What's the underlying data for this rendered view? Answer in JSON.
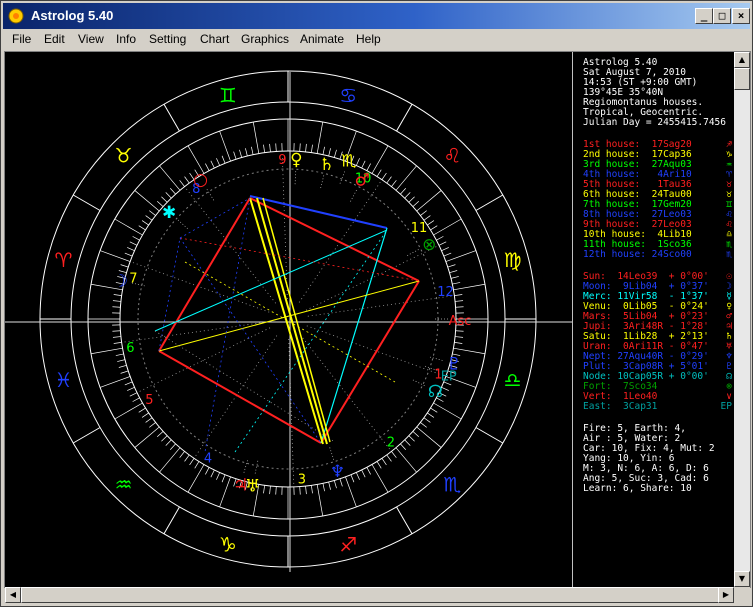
{
  "window": {
    "title": "Astrolog 5.40",
    "minimize": "_",
    "maximize": "□",
    "close": "×"
  },
  "menu": [
    "File",
    "Edit",
    "View",
    "Info",
    "Setting",
    "Chart",
    "Graphics",
    "Animate",
    "Help"
  ],
  "info": {
    "header": [
      "Astrolog 5.40",
      "Sat August 7, 2010",
      "14:53 (ST +9:00 GMT)",
      "139°45E 35°40N",
      "Regiomontanus houses.",
      "Tropical, Geocentric.",
      "Julian Day = 2455415.7456"
    ],
    "houses": [
      {
        "text": "1st house:  17Sag20",
        "color": "#ff2020",
        "glyph": "♐"
      },
      {
        "text": "2nd house:  17Cap36",
        "color": "#ffff00",
        "glyph": "♑"
      },
      {
        "text": "3rd house:  27Aqu03",
        "color": "#00ff00",
        "glyph": "♒"
      },
      {
        "text": "4th house:   4Ari10",
        "color": "#2040ff",
        "glyph": "♈"
      },
      {
        "text": "5th house:   1Tau36",
        "color": "#ff2020",
        "glyph": "♉"
      },
      {
        "text": "6th house:  24Tau00",
        "color": "#ffff00",
        "glyph": "♉"
      },
      {
        "text": "7th house:  17Gem20",
        "color": "#00ff00",
        "glyph": "♊"
      },
      {
        "text": "8th house:  27Leo03",
        "color": "#2040ff",
        "glyph": "♌"
      },
      {
        "text": "9th house:  27Leo03",
        "color": "#ff2020",
        "glyph": "♌"
      },
      {
        "text": "10th house:  4Lib10",
        "color": "#ffff00",
        "glyph": "♎"
      },
      {
        "text": "11th house:  1Sco36",
        "color": "#00ff00",
        "glyph": "♏"
      },
      {
        "text": "12th house: 24Sco00",
        "color": "#2040ff",
        "glyph": "♏"
      }
    ],
    "planets": [
      {
        "text": "Sun:  14Leo39  + 0°00'",
        "color": "#ff2020",
        "glyph": "☉"
      },
      {
        "text": "Moon:  9Lib04  + 0°37'",
        "color": "#2040ff",
        "glyph": "☽"
      },
      {
        "text": "Merc: 11Vir58  - 1°37'",
        "color": "#00ffff",
        "glyph": "☿"
      },
      {
        "text": "Venu:  0Lib05  - 0°24'",
        "color": "#ffff00",
        "glyph": "♀"
      },
      {
        "text": "Mars:  5Lib04  + 0°23'",
        "color": "#ff2020",
        "glyph": "♂"
      },
      {
        "text": "Jupi:  3Ari48R - 1°28'",
        "color": "#ff2020",
        "glyph": "♃"
      },
      {
        "text": "Satu:  1Lib28  + 2°13'",
        "color": "#ffff00",
        "glyph": "♄"
      },
      {
        "text": "Uran:  0Ari11R - 0°47'",
        "color": "#ff2020",
        "glyph": "♅"
      },
      {
        "text": "Nept: 27Aqu40R - 0°29'",
        "color": "#2040ff",
        "glyph": "♆"
      },
      {
        "text": "Plut:  3Cap08R + 5°01'",
        "color": "#2040ff",
        "glyph": "♇"
      },
      {
        "text": "Node: 10Cap05R + 0°00'",
        "color": "#00c0c0",
        "glyph": "☊"
      },
      {
        "text": "Fort:  7Sco34",
        "color": "#00a000",
        "glyph": "⊗"
      },
      {
        "text": "Vert:  1Leo40",
        "color": "#ff2020",
        "glyph": "∨"
      },
      {
        "text": "East:  3Cap31",
        "color": "#00a0a0",
        "glyph": "EP"
      }
    ],
    "summary": [
      "Fire: 5, Earth: 4,",
      "Air : 5, Water: 2",
      "Car: 10, Fix: 4, Mut: 2",
      "Yang: 10, Yin: 6",
      "M: 3, N: 6, A: 6, D: 6",
      "Ang: 5, Suc: 3, Cad: 6",
      "Learn: 6, Share: 10"
    ]
  },
  "wheel": {
    "signs": [
      {
        "glyph": "♐",
        "color": "#ff2020",
        "deg": 255
      },
      {
        "glyph": "♑",
        "color": "#ffff00",
        "deg": 285
      },
      {
        "glyph": "♒",
        "color": "#00ff00",
        "deg": 315
      },
      {
        "glyph": "♓",
        "color": "#2040ff",
        "deg": 345
      },
      {
        "glyph": "♈",
        "color": "#ff2020",
        "deg": 15
      },
      {
        "glyph": "♉",
        "color": "#ffff00",
        "deg": 45
      },
      {
        "glyph": "♊",
        "color": "#00ff00",
        "deg": 75
      },
      {
        "glyph": "♋",
        "color": "#2040ff",
        "deg": 105
      },
      {
        "glyph": "♌",
        "color": "#ff2020",
        "deg": 135
      },
      {
        "glyph": "♍",
        "color": "#ffff00",
        "deg": 165
      },
      {
        "glyph": "♎",
        "color": "#00ff00",
        "deg": 195
      },
      {
        "glyph": "♏",
        "color": "#2040ff",
        "deg": 225
      }
    ],
    "house_numbers": [
      {
        "n": "1",
        "color": "#ff2020",
        "deg": 200
      },
      {
        "n": "2",
        "color": "#00ff00",
        "deg": 230
      },
      {
        "n": "3",
        "color": "#ffff00",
        "deg": 265
      },
      {
        "n": "4",
        "color": "#2040ff",
        "deg": 300
      },
      {
        "n": "5",
        "color": "#ff2020",
        "deg": 330
      },
      {
        "n": "6",
        "color": "#00ff00",
        "deg": 350
      },
      {
        "n": "7",
        "color": "#ffff00",
        "deg": 15
      },
      {
        "n": "8",
        "color": "#2040ff",
        "deg": 55
      },
      {
        "n": "9",
        "color": "#ff2020",
        "deg": 88
      },
      {
        "n": "10",
        "color": "#00ff00",
        "deg": 118
      },
      {
        "n": "11",
        "color": "#ffff00",
        "deg": 145
      },
      {
        "n": "12",
        "color": "#2040ff",
        "deg": 170
      }
    ],
    "cusp_degs": [
      200,
      232,
      268,
      304,
      334,
      352,
      20,
      52,
      88,
      124,
      154,
      172
    ],
    "planet_marks": [
      {
        "glyph": "♂",
        "color": "#ff2020",
        "deg": 118,
        "r": 158
      },
      {
        "glyph": "♏",
        "color": "#ffff00",
        "deg": 111,
        "r": 170
      },
      {
        "glyph": "♄",
        "color": "#ffff00",
        "deg": 104,
        "r": 160
      },
      {
        "glyph": "♀",
        "color": "#ffff00",
        "deg": 93,
        "r": 160
      },
      {
        "glyph": "○",
        "color": "#ff2020",
        "deg": 58,
        "r": 165
      },
      {
        "glyph": "✱",
        "color": "#00ffff",
        "deg": 42,
        "r": 160
      },
      {
        "glyph": "☽",
        "color": "#2040ff",
        "deg": 13,
        "r": 172
      },
      {
        "glyph": "⊗",
        "color": "#00a000",
        "deg": 152,
        "r": 160
      },
      {
        "glyph": "Asc",
        "color": "#ff2020",
        "deg": 180,
        "r": 172
      },
      {
        "glyph": "♇",
        "color": "#2040ff",
        "deg": 195,
        "r": 172
      },
      {
        "glyph": "EP",
        "color": "#00a0a0",
        "deg": 199,
        "r": 170
      },
      {
        "glyph": "☊",
        "color": "#00c0c0",
        "deg": 206,
        "r": 164
      },
      {
        "glyph": "♆",
        "color": "#2040ff",
        "deg": 252,
        "r": 160
      },
      {
        "glyph": "♅",
        "color": "#ffff00",
        "deg": 282,
        "r": 170
      },
      {
        "glyph": "♃",
        "color": "#ff2020",
        "deg": 286,
        "r": 172
      }
    ]
  }
}
